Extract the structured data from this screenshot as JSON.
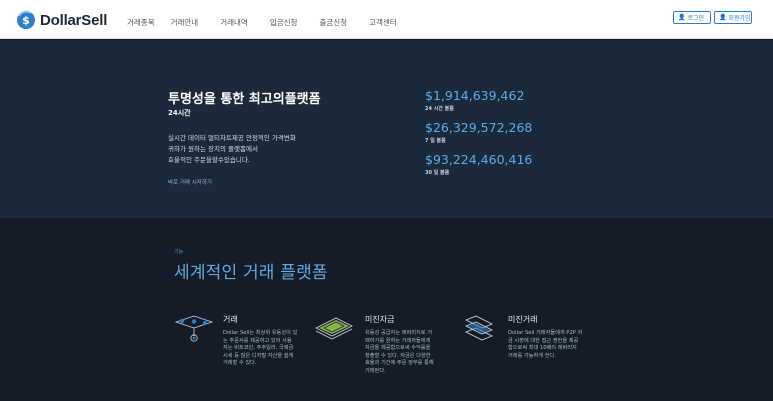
{
  "brand": {
    "name": "DollarSell",
    "color": "#2f7ec7"
  },
  "nav": {
    "items": [
      "거래종목",
      "거래안내",
      "거래내역",
      "입금신청",
      "출금신청",
      "고객센터"
    ]
  },
  "auth": {
    "login_label": "로그인",
    "register_label": "회원가입"
  },
  "hero": {
    "title": "투명성을 통한 최고의플랫폼",
    "subtitle": "24시간",
    "description": [
      "실시간 데이터 멀티차트제공 안정적인 가격변화",
      "귀하가 원하는 장치의 플랫폼에서",
      "효율적인 주문을할수있습니다."
    ],
    "cta": "바로 거래 시작하기",
    "stats": [
      {
        "value": "$1,914,639,462",
        "label": "24 시간 볼륨"
      },
      {
        "value": "$26,329,572,268",
        "label": "7 일 볼륨"
      },
      {
        "value": "$93,224,460,416",
        "label": "30 일 볼륨"
      }
    ]
  },
  "features": {
    "kicker": "기능",
    "heading": "세계적인 거래 플랫폼",
    "cards": [
      {
        "icon": "exchange-icon",
        "title": "거래",
        "body": [
          "Dollar Sell는 최상위 유동성이 있",
          "는 주문서를 제공하고 있어 사용",
          "자는 비트코인, 주주일러, 국제금",
          "시세 등 많은 디지털 자산을 쉽게",
          "거래할 수 있다."
        ]
      },
      {
        "icon": "margin-funds-icon",
        "title": "미진자금",
        "body": [
          "유동성 공급자는 레버리지로 거",
          "래하기를 원하는 거래자들에게",
          "자금을 제공함으로써 수익률을",
          "창출할 수 있다. 자금은 다양한",
          "효율과 기간에 주문 정부를 통해",
          "거래된다."
        ]
      },
      {
        "icon": "margin-trading-icon",
        "title": "미진거래",
        "body": [
          "Dollar Sell 거래자들에게 P2P 자",
          "금 시장에 대한 접근 권한을 제공",
          "함으로써 최대 10배의 레버리지",
          "거래를 가능하게 한다."
        ]
      }
    ]
  }
}
